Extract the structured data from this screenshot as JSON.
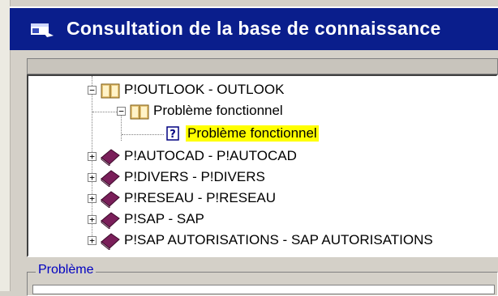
{
  "window": {
    "title": "Consultation de la base de connaissance",
    "title_icon": "window-document-icon"
  },
  "tree": {
    "nodes": [
      {
        "label": "P!OUTLOOK - OUTLOOK",
        "state": "expanded",
        "icon": "open-book-icon"
      },
      {
        "label": "Problème fonctionnel",
        "state": "expanded",
        "icon": "open-book-icon"
      },
      {
        "label": "Problème fonctionnel",
        "state": "leaf-selected",
        "icon": "help-page-icon"
      },
      {
        "label": "P!AUTOCAD - P!AUTOCAD",
        "state": "collapsed",
        "icon": "closed-book-icon"
      },
      {
        "label": "P!DIVERS - P!DIVERS",
        "state": "collapsed",
        "icon": "closed-book-icon"
      },
      {
        "label": "P!RESEAU - P!RESEAU",
        "state": "collapsed",
        "icon": "closed-book-icon"
      },
      {
        "label": "P!SAP - SAP",
        "state": "collapsed",
        "icon": "closed-book-icon"
      },
      {
        "label": "P!SAP AUTORISATIONS - SAP AUTORISATIONS",
        "state": "collapsed",
        "icon": "closed-book-icon"
      }
    ],
    "expander_expanded": "⊟",
    "expander_collapsed": "⊞",
    "selected_highlight_color": "#ffff00",
    "book_color": "#7a1f5a"
  },
  "probleme_group": {
    "label": "Problème"
  },
  "colors": {
    "titlebar": "#0a1e8c",
    "title_text": "#ffffff",
    "group_label": "#0000c0"
  }
}
